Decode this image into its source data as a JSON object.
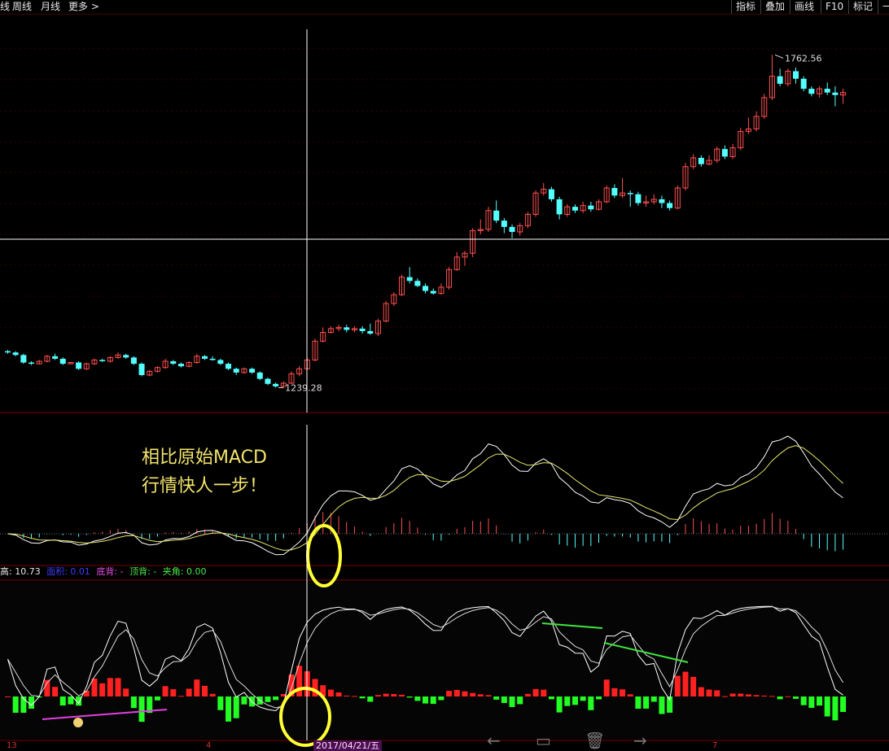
{
  "topbar": {
    "left_items": [
      "线",
      "周线",
      "月线",
      "更多 >"
    ],
    "right_items": [
      "指标",
      "叠加",
      "画线",
      "F10",
      "标记",
      "一"
    ]
  },
  "price": {
    "high_label": "1762.56",
    "low_label": "1239.28",
    "candles": [
      [
        1290,
        1288,
        1292,
        1286
      ],
      [
        1288,
        1284,
        1290,
        1282
      ],
      [
        1284,
        1272,
        1286,
        1270
      ],
      [
        1272,
        1270,
        1274,
        1268
      ],
      [
        1270,
        1274,
        1276,
        1269
      ],
      [
        1274,
        1282,
        1284,
        1272
      ],
      [
        1282,
        1278,
        1286,
        1276
      ],
      [
        1278,
        1270,
        1280,
        1268
      ],
      [
        1270,
        1272,
        1273,
        1269
      ],
      [
        1272,
        1262,
        1274,
        1260
      ],
      [
        1262,
        1270,
        1272,
        1260
      ],
      [
        1270,
        1276,
        1278,
        1268
      ],
      [
        1276,
        1274,
        1278,
        1273
      ],
      [
        1274,
        1280,
        1282,
        1272
      ],
      [
        1280,
        1284,
        1288,
        1278
      ],
      [
        1284,
        1280,
        1286,
        1278
      ],
      [
        1280,
        1270,
        1282,
        1268
      ],
      [
        1270,
        1252,
        1272,
        1250
      ],
      [
        1252,
        1258,
        1260,
        1250
      ],
      [
        1258,
        1264,
        1266,
        1256
      ],
      [
        1264,
        1274,
        1278,
        1262
      ],
      [
        1274,
        1270,
        1276,
        1268
      ],
      [
        1270,
        1266,
        1272,
        1264
      ],
      [
        1266,
        1272,
        1274,
        1264
      ],
      [
        1272,
        1282,
        1286,
        1270
      ],
      [
        1282,
        1278,
        1284,
        1276
      ],
      [
        1278,
        1276,
        1282,
        1275
      ],
      [
        1276,
        1270,
        1278,
        1268
      ],
      [
        1270,
        1262,
        1272,
        1260
      ],
      [
        1262,
        1256,
        1264,
        1252
      ],
      [
        1256,
        1262,
        1264,
        1254
      ],
      [
        1262,
        1256,
        1264,
        1254
      ],
      [
        1256,
        1246,
        1258,
        1244
      ],
      [
        1246,
        1238,
        1248,
        1236
      ],
      [
        1238,
        1234,
        1240,
        1232
      ],
      [
        1234,
        1239,
        1242,
        1232
      ],
      [
        1239,
        1254,
        1258,
        1238
      ],
      [
        1254,
        1262,
        1266,
        1250
      ],
      [
        1262,
        1276,
        1280,
        1260
      ],
      [
        1276,
        1306,
        1310,
        1274
      ],
      [
        1306,
        1320,
        1328,
        1304
      ],
      [
        1320,
        1326,
        1330,
        1318
      ],
      [
        1326,
        1328,
        1332,
        1322
      ],
      [
        1328,
        1324,
        1332,
        1320
      ],
      [
        1324,
        1326,
        1330,
        1320
      ],
      [
        1326,
        1322,
        1330,
        1318
      ],
      [
        1322,
        1318,
        1334,
        1316
      ],
      [
        1318,
        1338,
        1342,
        1314
      ],
      [
        1338,
        1366,
        1370,
        1336
      ],
      [
        1366,
        1380,
        1384,
        1362
      ],
      [
        1380,
        1408,
        1412,
        1378
      ],
      [
        1408,
        1402,
        1424,
        1398
      ],
      [
        1402,
        1394,
        1406,
        1392
      ],
      [
        1394,
        1386,
        1398,
        1382
      ],
      [
        1386,
        1382,
        1390,
        1380
      ],
      [
        1382,
        1392,
        1398,
        1380
      ],
      [
        1392,
        1420,
        1424,
        1388
      ],
      [
        1420,
        1440,
        1448,
        1418
      ],
      [
        1440,
        1446,
        1450,
        1426
      ],
      [
        1446,
        1482,
        1486,
        1440
      ],
      [
        1482,
        1484,
        1500,
        1476
      ],
      [
        1484,
        1514,
        1520,
        1480
      ],
      [
        1514,
        1498,
        1530,
        1494
      ],
      [
        1498,
        1488,
        1502,
        1478
      ],
      [
        1488,
        1480,
        1492,
        1470
      ],
      [
        1480,
        1490,
        1494,
        1474
      ],
      [
        1490,
        1508,
        1512,
        1486
      ],
      [
        1508,
        1542,
        1546,
        1504
      ],
      [
        1542,
        1548,
        1558,
        1538
      ],
      [
        1548,
        1532,
        1552,
        1528
      ],
      [
        1532,
        1508,
        1536,
        1500
      ],
      [
        1508,
        1520,
        1524,
        1504
      ],
      [
        1520,
        1514,
        1524,
        1510
      ],
      [
        1514,
        1522,
        1528,
        1510
      ],
      [
        1522,
        1516,
        1528,
        1512
      ],
      [
        1516,
        1528,
        1532,
        1514
      ],
      [
        1528,
        1550,
        1554,
        1526
      ],
      [
        1550,
        1538,
        1556,
        1534
      ],
      [
        1538,
        1542,
        1566,
        1534
      ],
      [
        1542,
        1540,
        1546,
        1520
      ],
      [
        1540,
        1526,
        1544,
        1522
      ],
      [
        1526,
        1528,
        1538,
        1520
      ],
      [
        1528,
        1532,
        1540,
        1524
      ],
      [
        1532,
        1526,
        1538,
        1518
      ],
      [
        1526,
        1518,
        1530,
        1514
      ],
      [
        1518,
        1550,
        1554,
        1516
      ],
      [
        1550,
        1584,
        1590,
        1546
      ],
      [
        1584,
        1598,
        1604,
        1580
      ],
      [
        1598,
        1588,
        1602,
        1584
      ],
      [
        1588,
        1594,
        1602,
        1586
      ],
      [
        1594,
        1612,
        1616,
        1590
      ],
      [
        1612,
        1600,
        1618,
        1596
      ],
      [
        1600,
        1614,
        1620,
        1596
      ],
      [
        1614,
        1640,
        1646,
        1610
      ],
      [
        1640,
        1644,
        1662,
        1636
      ],
      [
        1644,
        1664,
        1672,
        1640
      ],
      [
        1664,
        1694,
        1700,
        1660
      ],
      [
        1694,
        1728,
        1762,
        1690
      ],
      [
        1728,
        1716,
        1740,
        1712
      ],
      [
        1716,
        1736,
        1740,
        1712
      ],
      [
        1736,
        1724,
        1742,
        1716
      ],
      [
        1724,
        1708,
        1728,
        1704
      ],
      [
        1708,
        1700,
        1712,
        1696
      ],
      [
        1700,
        1708,
        1712,
        1694
      ],
      [
        1708,
        1702,
        1718,
        1698
      ],
      [
        1702,
        1698,
        1712,
        1680
      ],
      [
        1698,
        1702,
        1708,
        1684
      ]
    ]
  },
  "macd": {
    "annotation_line1": "相比原始MACD",
    "annotation_line2": "行情快人一步！"
  },
  "indicator_bar": {
    "items": [
      {
        "text": "高: 10.73",
        "color": "#e6e6e6"
      },
      {
        "text": "面积: 0.01",
        "color": "#3b3bff"
      },
      {
        "text": "底背: -",
        "color": "#e64ce6"
      },
      {
        "text": "顶背: -",
        "color": "#4ce64c"
      },
      {
        "text": "夹角: 0.00",
        "color": "#4ce64c"
      }
    ]
  },
  "bottom": {
    "date_label": "2017/04/21/五",
    "axis_labels": [
      "13",
      "4",
      "7"
    ]
  },
  "colors": {
    "up": "#ff4f4f",
    "down": "#54ffff",
    "ma_white": "#ffffff",
    "ma_yellow": "#e8e66c",
    "highlight": "#ffff33"
  }
}
